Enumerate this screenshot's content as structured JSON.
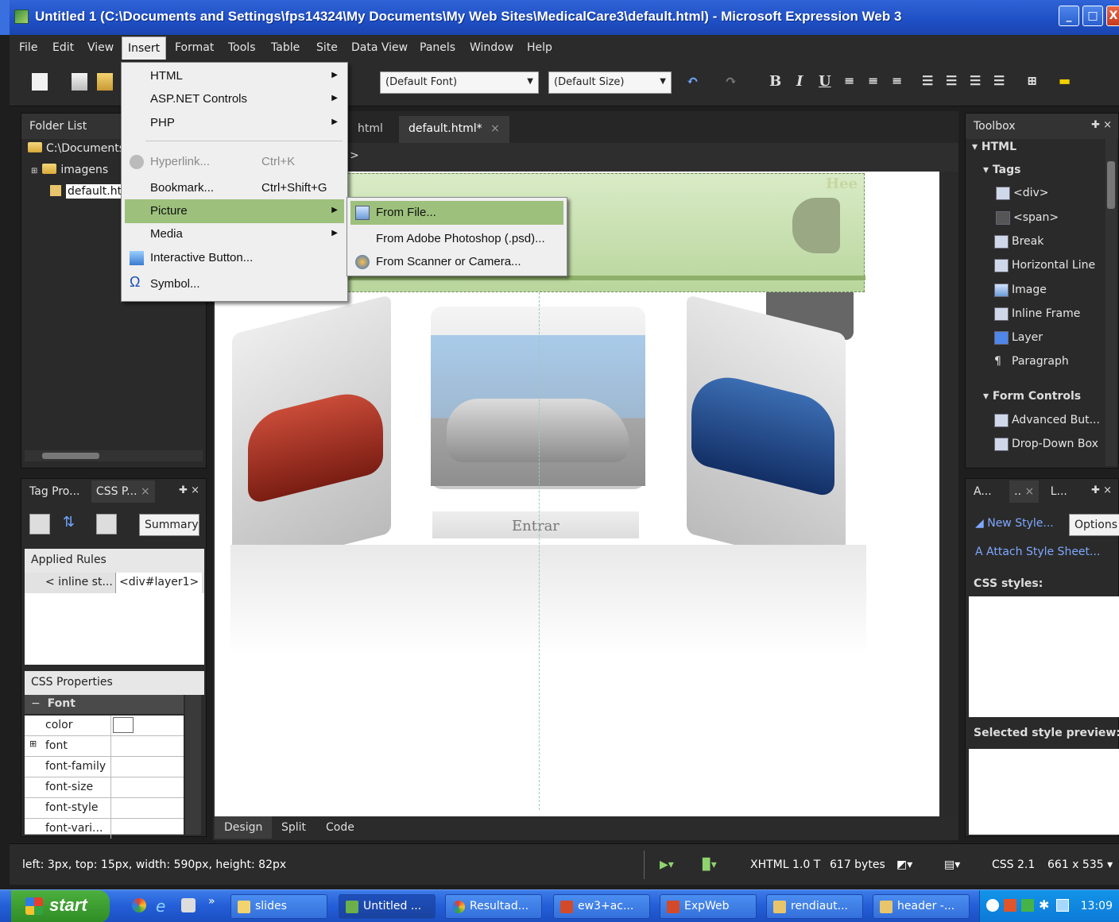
{
  "window": {
    "title": "Untitled 1 (C:\\Documents and Settings\\fps14324\\My Documents\\My Web Sites\\MedicalCare3\\default.html) - Microsoft Expression Web 3",
    "min": "_",
    "max": "□",
    "close": "X"
  },
  "menubar": [
    "File",
    "Edit",
    "View",
    "Insert",
    "Format",
    "Tools",
    "Table",
    "Site",
    "Data View",
    "Panels",
    "Window",
    "Help"
  ],
  "toolbar": {
    "font": "(Default Font)",
    "size": "(Default Size)",
    "bold": "B",
    "italic": "I",
    "underline": "U"
  },
  "insert_menu": {
    "items": [
      {
        "label": "HTML",
        "submenu": true
      },
      {
        "label": "ASP.NET Controls",
        "submenu": true
      },
      {
        "label": "PHP",
        "submenu": true
      },
      {
        "label": "Hyperlink...",
        "shortcut": "Ctrl+K",
        "disabled": true
      },
      {
        "label": "Bookmark...",
        "shortcut": "Ctrl+Shift+G"
      },
      {
        "label": "Picture",
        "submenu": true,
        "highlighted": true
      },
      {
        "label": "Media",
        "submenu": true
      },
      {
        "label": "Interactive Button..."
      },
      {
        "label": "Symbol..."
      }
    ]
  },
  "picture_submenu": [
    "From File...",
    "From Adobe Photoshop (.psd)...",
    "From Scanner or Camera..."
  ],
  "folder_list": {
    "title": "Folder List",
    "root": "C:\\Documents",
    "items": [
      "imagens",
      "default.ht"
    ]
  },
  "editor": {
    "tabs": [
      "html",
      "default.html*"
    ],
    "tab_close": "×",
    "quicktag": ">",
    "canvas_text": "Entrar",
    "canvas_header_text": "Hee",
    "view_tabs": [
      "Design",
      "Split",
      "Code"
    ]
  },
  "tag_panel": {
    "tabs": [
      "Tag Pro...",
      "CSS P..."
    ],
    "summary_button": "Summary",
    "applied_rules_label": "Applied Rules",
    "rule_source": "< inline st...",
    "rule_selector": "<div#layer1>",
    "css_properties_label": "CSS Properties",
    "category": "Font",
    "properties": [
      "color",
      "font",
      "font-family",
      "font-size",
      "font-style",
      "font-vari..."
    ]
  },
  "toolbox": {
    "title": "Toolbox",
    "html_label": "HTML",
    "tags_label": "Tags",
    "tags": [
      "<div>",
      "<span>",
      "Break",
      "Horizontal Line",
      "Image",
      "Inline Frame",
      "Layer",
      "Paragraph"
    ],
    "form_label": "Form Controls",
    "forms": [
      "Advanced But...",
      "Drop-Down Box"
    ]
  },
  "styles_panel": {
    "tabs": [
      "A...",
      "..",
      "L..."
    ],
    "new_style": "New Style...",
    "options": "Options",
    "attach": "Attach Style Sheet...",
    "css_styles": "CSS styles:",
    "preview": "Selected style preview:"
  },
  "status": {
    "position": "left: 3px, top: 15px, width: 590px, height: 82px",
    "doctype": "XHTML 1.0 T",
    "size": "617 bytes",
    "css": "CSS 2.1",
    "dimensions": "661 x 535"
  },
  "taskbar": {
    "start": "start",
    "chevron": "»",
    "tasks": [
      "slides",
      "Untitled ...",
      "Resultad...",
      "ew3+ac...",
      "ExpWeb",
      "rendiaut...",
      "header -..."
    ],
    "clock": "13:09"
  },
  "colors": {
    "accent": "#9dc17c",
    "panel": "#2a2a2a",
    "title": "#2f63d6"
  }
}
